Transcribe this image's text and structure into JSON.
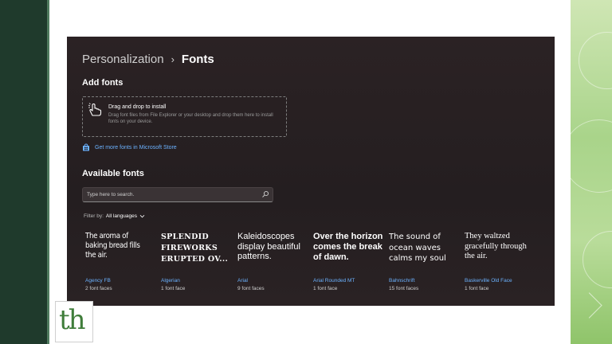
{
  "breadcrumb": {
    "parent": "Personalization",
    "separator": "›",
    "current": "Fonts"
  },
  "add_fonts": {
    "heading": "Add fonts",
    "drop_title": "Drag and drop to install",
    "drop_description": "Drag font files from File Explorer or your desktop and drop them here to install fonts on your device."
  },
  "store_link": "Get more fonts in Microsoft Store",
  "available": {
    "heading": "Available fonts",
    "search_placeholder": "Type here to search.",
    "filter_label": "Filter by:",
    "filter_value": "All languages"
  },
  "fonts": [
    {
      "sample": "The aroma of baking bread fills the air.",
      "name": "Agency FB",
      "faces": "2 font faces"
    },
    {
      "sample": "Splendid fireworks erupted ov...",
      "name": "Algerian",
      "faces": "1 font face"
    },
    {
      "sample": "Kaleidoscopes display beautiful patterns.",
      "name": "Arial",
      "faces": "9 font faces"
    },
    {
      "sample": "Over the horizon comes the break of dawn.",
      "name": "Arial Rounded MT",
      "faces": "1 font face"
    },
    {
      "sample": "The sound of ocean waves calms my soul",
      "name": "Bahnschrift",
      "faces": "15 font faces"
    },
    {
      "sample": "They waltzed gracefully through the air.",
      "name": "Baskerville Old Face",
      "faces": "1 font face"
    }
  ],
  "logo_text": "th",
  "colors": {
    "window_bg": "#241e20",
    "link": "#6bb2ff",
    "accent_green": "#3f7d3a"
  },
  "icons": {
    "drop": "hand-pointer-icon",
    "store": "store-bag-icon",
    "search": "search-icon",
    "filter": "chevron-down-icon"
  }
}
